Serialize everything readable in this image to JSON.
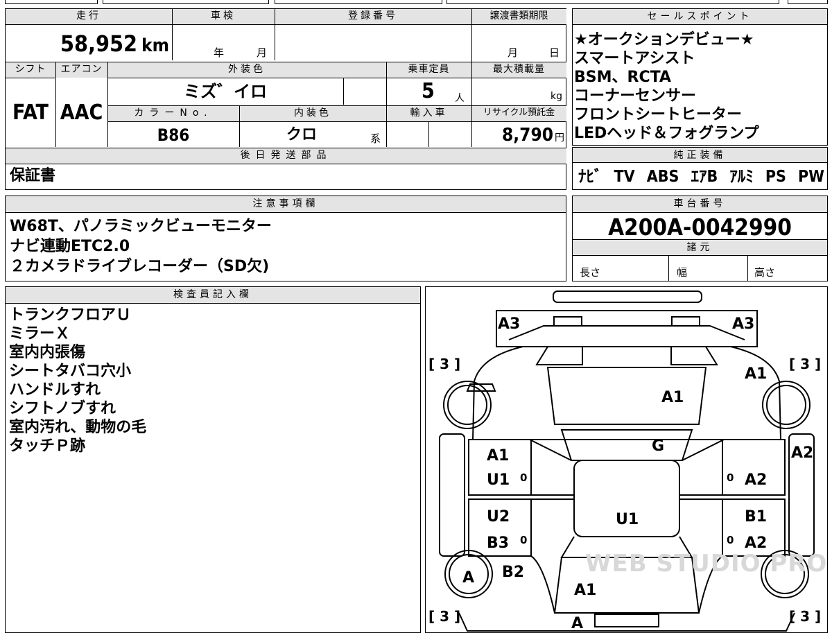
{
  "top_info": {
    "mileage_label": "走行",
    "mileage": "58,952",
    "mileage_unit": "km",
    "shaken_label": "車検",
    "shaken_year": "年",
    "shaken_month": "月",
    "reg_label": "登録番号",
    "deadline_label": "譲渡書類期限",
    "deadline_month": "月",
    "deadline_day": "日",
    "shift_label": "シフト",
    "shift": "FAT",
    "ac_label": "エアコン",
    "ac": "AAC",
    "exterior_label": "外装色",
    "exterior": "ミズ゛イロ",
    "capacity_label": "乗車定員",
    "capacity": "5",
    "capacity_unit": "人",
    "load_label": "最大積載量",
    "load_unit": "kg",
    "color_no_label": "カラーNo.",
    "color_no": "B86",
    "interior_label": "内装色",
    "interior": "クロ",
    "interior_suffix": "系",
    "import_label": "輸入車",
    "recycle_label": "リサイクル預託金",
    "recycle": "8,790",
    "recycle_unit": "円",
    "later_parts_label": "後日発送部品",
    "later_parts": "保証書"
  },
  "sales_points": {
    "label": "セールスポイント",
    "items": [
      "★オークションデビュー★",
      "スマートアシスト",
      "BSM、RCTA",
      "コーナーセンサー",
      "フロントシートヒーター",
      "LEDヘッド＆フォグランプ"
    ]
  },
  "genuine_equipment": {
    "label": "純正装備",
    "items": [
      "ﾅﾋﾞ",
      "TV",
      "ABS",
      "ｴｱB",
      "ｱﾙﾐ",
      "PS",
      "PW"
    ]
  },
  "notes": {
    "label": "注意事項欄",
    "lines": [
      "W68T、パノラミックビューモニター",
      "ナビ連動ETC2.0",
      "２カメラドライブレコーダー（SD欠)"
    ]
  },
  "chassis": {
    "label": "車台番号",
    "number": "A200A-0042990"
  },
  "specs": {
    "label": "諸元",
    "length": "長さ",
    "width": "幅",
    "height": "高さ"
  },
  "inspector": {
    "label": "検査員記入欄",
    "lines": [
      "トランクフロアＵ",
      "ミラーＸ",
      "室内内張傷",
      "シートタバコ穴小",
      "ハンドルすれ",
      "シフトノブすれ",
      "室内汚れ、動物の毛",
      "タッチＰ跡"
    ]
  },
  "diagram": {
    "marks": {
      "a3_left": "A3",
      "a3_right": "A3",
      "a1_top_right": "A1",
      "a1_hood": "A1",
      "g_glass": "G",
      "a2_right": "A2",
      "a1_left_front_door": "A1",
      "u1_left_front_door": "U1",
      "a2_right_front_door": "A2",
      "u2_left_rear_door": "U2",
      "b3_left_rear_door": "B3",
      "b1_right_rear_door": "B1",
      "a2_right_rear_door": "A2",
      "u1_roof": "U1",
      "b2_left_rear": "B2",
      "a1_rear": "A1",
      "a_tire": "A",
      "a_bottom": "A",
      "tire_tl": "[ 3 ]",
      "tire_tr": "[ 3 ]",
      "tire_bl": "[ 3 ]",
      "tire_br": "[ 3 ]",
      "zero_1": "0",
      "zero_2": "0",
      "zero_3": "0",
      "zero_4": "0"
    },
    "watermark": "WEB STUDIO PRO"
  }
}
